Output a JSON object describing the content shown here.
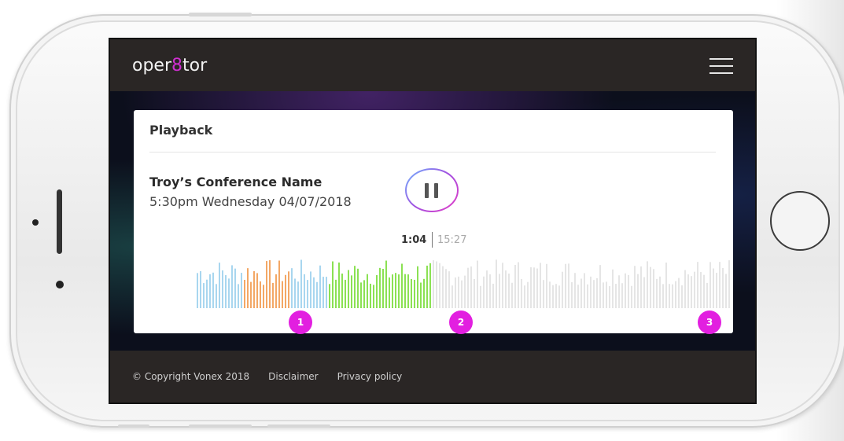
{
  "app": {
    "logo_prefix": "oper",
    "logo_accent": "8",
    "logo_suffix": "tor",
    "accent_color": "#cf2fd0",
    "menu_icon": "hamburger-menu-icon"
  },
  "playback": {
    "title": "Playback",
    "conference_name": "Troy’s Conference Name",
    "datetime": "5:30pm Wednesday 04/07/2018",
    "state": "playing",
    "control_icon": "pause-icon",
    "current_time": "1:04",
    "total_time": "15:27",
    "progress": 0.44
  },
  "waveform": {
    "played_colors": [
      "#a8d6ef",
      "#f3a765",
      "#a8d6ef",
      "#8be153"
    ],
    "unplayed_color": "#e5e5e5",
    "segment_fractions": [
      0.2,
      0.2,
      0.15,
      0.45
    ]
  },
  "markers": [
    {
      "label": "1",
      "position": 0.2
    },
    {
      "label": "2",
      "position": 0.48
    },
    {
      "label": "3",
      "position": 0.95
    }
  ],
  "footer": {
    "copyright": "© Copyright Vonex 2018",
    "disclaimer": "Disclaimer",
    "privacy": "Privacy policy"
  }
}
